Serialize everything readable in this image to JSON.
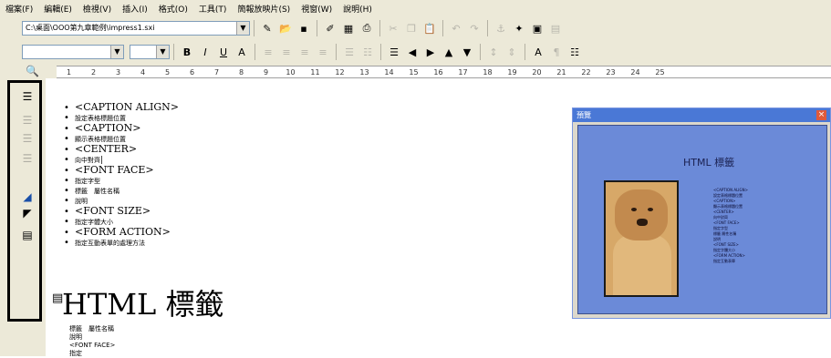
{
  "menubar": {
    "items": [
      "檔案(F)",
      "編輯(E)",
      "檢視(V)",
      "插入(I)",
      "格式(O)",
      "工具(T)",
      "簡報放映片(S)",
      "視窗(W)",
      "說明(H)"
    ]
  },
  "toolbar1": {
    "path_value": "C:\\桌面\\OOO第九章範例\\impress1.sxi"
  },
  "ruler": {
    "numbers": [
      "1",
      "2",
      "3",
      "4",
      "5",
      "6",
      "7",
      "8",
      "9",
      "10",
      "11",
      "12",
      "13",
      "14",
      "15",
      "16",
      "17",
      "18",
      "19",
      "20",
      "21",
      "22",
      "23",
      "24",
      "25"
    ]
  },
  "outline": {
    "items": [
      {
        "title": "<CAPTION ALIGN>",
        "subs": [
          "設定表格標題位置"
        ]
      },
      {
        "title": "<CAPTION>",
        "subs": [
          "顯示表格標題位置"
        ]
      },
      {
        "title": "<CENTER>",
        "subs": [
          "向中對齊"
        ]
      },
      {
        "title": "<FONT FACE>",
        "subs": [
          "指定字型",
          "標籤　屬性名稱",
          "說明"
        ]
      },
      {
        "title": "<FONT SIZE>",
        "subs": [
          "指定字體大小"
        ]
      },
      {
        "title": "<FORM ACTION>",
        "subs": [
          "指定互動表單的處理方法"
        ]
      }
    ]
  },
  "slide2": {
    "title": "HTML 標籤",
    "lines": [
      "標籤　屬性名稱",
      "說明",
      "<FONT FACE>",
      "指定"
    ]
  },
  "preview": {
    "window_title": "預覽",
    "slide_heading": "HTML 標籤",
    "slide_items": [
      "<CAPTION ALIGN>",
      "設定表格標題位置",
      "<CAPTION>",
      "顯示表格標題位置",
      "<CENTER>",
      "向中對齊",
      "<FONT FACE>",
      "指定字型",
      "標籤 屬性名稱",
      "說明",
      "<FONT SIZE>",
      "指定字體大小",
      "<FORM ACTION>",
      "指定互動表單"
    ]
  }
}
